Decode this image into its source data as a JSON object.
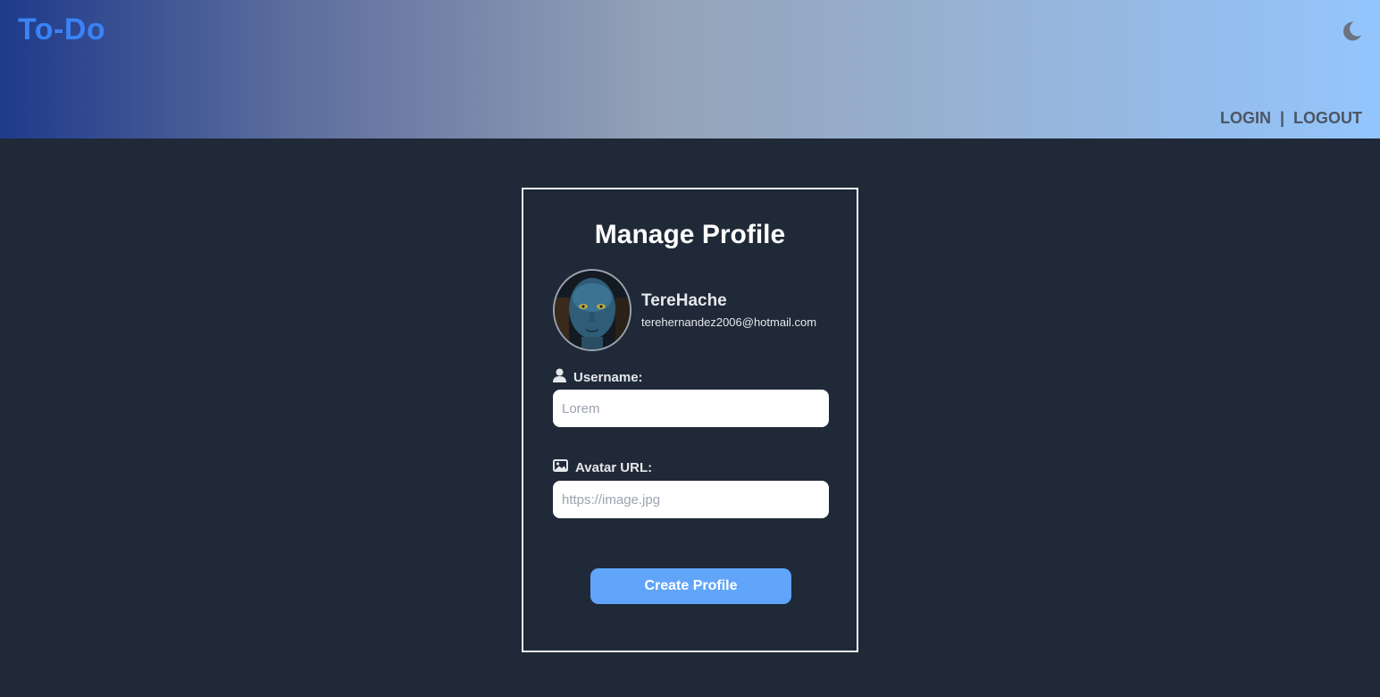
{
  "header": {
    "brand": "To-Do",
    "theme_icon": "moon-icon",
    "nav": {
      "login": "LOGIN",
      "separator": "|",
      "logout": "LOGOUT"
    }
  },
  "card": {
    "title": "Manage Profile",
    "profile": {
      "name": "TereHache",
      "email": "terehernandez2006@hotmail.com"
    },
    "username": {
      "icon": "user-icon",
      "label": "Username:",
      "value": "",
      "placeholder": "Lorem"
    },
    "avatar_url": {
      "icon": "image-icon",
      "label": "Avatar URL:",
      "value": "",
      "placeholder": "https://image.jpg"
    },
    "submit_label": "Create Profile"
  },
  "colors": {
    "background": "#1f2937",
    "brand": "#3b82f6",
    "button": "#60a5fa",
    "header_gradient": [
      "#1e3a8a",
      "#94a3b8",
      "#93c5fd"
    ]
  }
}
